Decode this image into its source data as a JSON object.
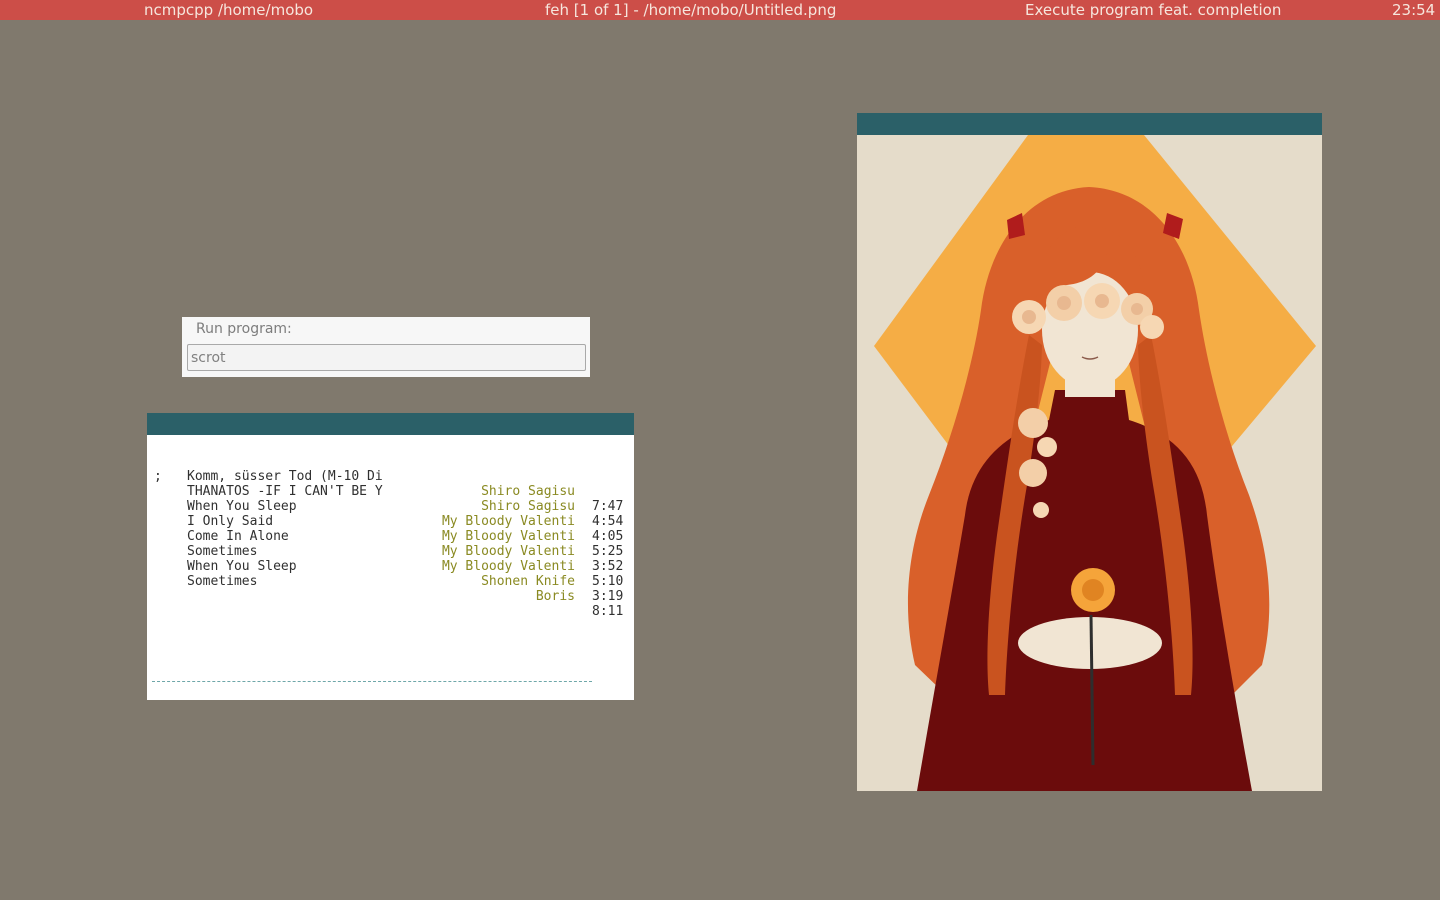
{
  "topbar": {
    "left": "ncmpcpp  /home/mobo",
    "center": "feh [1 of 1] - /home/mobo/Untitled.png",
    "right": "Execute program feat. completion",
    "clock": "23:54"
  },
  "run_dialog": {
    "label": "Run program:",
    "input_value": "scrot"
  },
  "playlist": [
    {
      "marker": "",
      "title": "Komm, süsser Tod (M-10 Di",
      "artist": "Shiro Sagisu",
      "time": "7:47"
    },
    {
      "marker": ";",
      "title": "THANATOS -IF I CAN'T BE Y",
      "artist": "Shiro Sagisu",
      "time": "4:54"
    },
    {
      "marker": "",
      "title": "When You Sleep",
      "artist": "My Bloody Valenti",
      "time": "4:05"
    },
    {
      "marker": "",
      "title": "I Only Said",
      "artist": "My Bloody Valenti",
      "time": "5:25"
    },
    {
      "marker": "",
      "title": "Come In Alone",
      "artist": "My Bloody Valenti",
      "time": "3:52"
    },
    {
      "marker": "",
      "title": "Sometimes",
      "artist": "My Bloody Valenti",
      "time": "5:10"
    },
    {
      "marker": "",
      "title": "When You Sleep",
      "artist": "Shonen Knife",
      "time": "3:19"
    },
    {
      "marker": "",
      "title": "Sometimes",
      "artist": "Boris",
      "time": "8:11"
    }
  ],
  "colors": {
    "desktop": "#80796d",
    "topbar": "#cc4e48",
    "titlebar": "#2b6068",
    "artist": "#8a8a22",
    "diamond": "#f5ad45",
    "dress": "#6b0c0c",
    "hair": "#d9602a"
  },
  "feh": {
    "image_subject": "illustration of a girl with long orange hair and roses over her eyes holding an orange rose"
  }
}
